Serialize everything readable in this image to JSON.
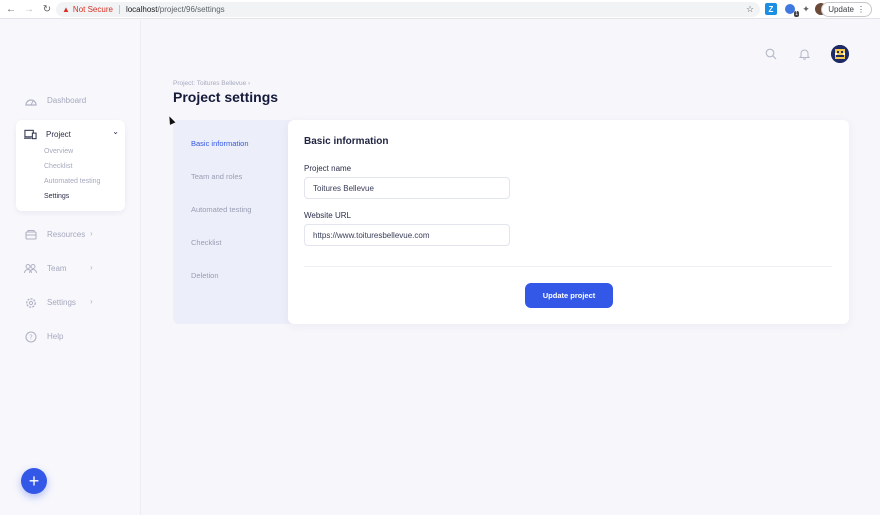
{
  "browser": {
    "not_secure": "Not Secure",
    "url_host": "localhost",
    "url_path": "/project/96/settings",
    "update_label": "Update",
    "ext_z_label": "Z",
    "ext_badge": "1"
  },
  "sidebar": {
    "items": [
      {
        "label": "Dashboard",
        "icon": "dashboard-icon"
      },
      {
        "label": "Resources",
        "icon": "resources-icon"
      },
      {
        "label": "Team",
        "icon": "team-icon"
      },
      {
        "label": "Settings",
        "icon": "gear-icon"
      },
      {
        "label": "Help",
        "icon": "help-icon"
      }
    ],
    "project": {
      "label": "Project",
      "sub_items": [
        "Overview",
        "Checklist",
        "Automated testing",
        "Settings"
      ],
      "active_sub": "Settings"
    },
    "fab_label": "+"
  },
  "header": {
    "breadcrumb": "Project: Toitures Bellevue",
    "title": "Project settings"
  },
  "tabs": [
    "Basic information",
    "Team and roles",
    "Automated testing",
    "Checklist",
    "Deletion"
  ],
  "active_tab": "Basic information",
  "form": {
    "section_title": "Basic information",
    "project_name_label": "Project name",
    "project_name_value": "Toitures Bellevue",
    "website_label": "Website URL",
    "website_value": "https://www.toituresbellevue.com",
    "submit_label": "Update project"
  },
  "colors": {
    "accent": "#3357e6",
    "text_dark": "#151a3a",
    "muted": "#a6a9bd",
    "warning": "#d93025"
  }
}
